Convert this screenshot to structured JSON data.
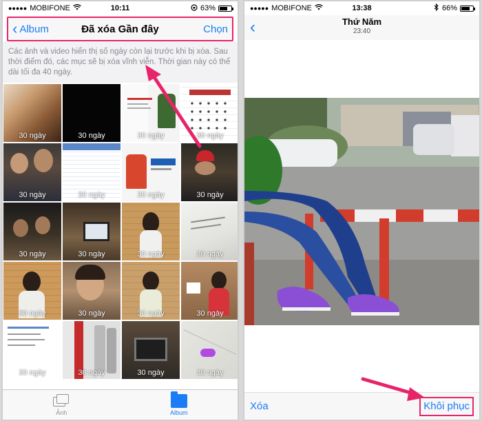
{
  "left": {
    "status": {
      "carrier": "MOBIFONE",
      "time": "10:11",
      "battery": "63%",
      "battery_level": 0.63
    },
    "nav": {
      "back_label": "Album",
      "title": "Đã xóa Gần đây",
      "action_label": "Chọn"
    },
    "info_text": "Các ảnh và video hiển thị số ngày còn lại trước khi bị xóa. Sau thời điểm đó, các mục sẽ bị xóa vĩnh viễn. Thời gian này có thể dài tối đa 40 ngày.",
    "days_label": "30 ngày",
    "tabs": [
      {
        "label": "Ảnh",
        "icon": "photos-icon"
      },
      {
        "label": "Album",
        "icon": "album-folder-icon"
      }
    ],
    "accent": "#e6246a"
  },
  "right": {
    "status": {
      "carrier": "MOBIFONE",
      "time": "13:38",
      "battery": "66%",
      "battery_level": 0.66
    },
    "title": "Thứ Năm",
    "subtitle": "23:40",
    "delete_label": "Xóa",
    "restore_label": "Khôi phục"
  }
}
